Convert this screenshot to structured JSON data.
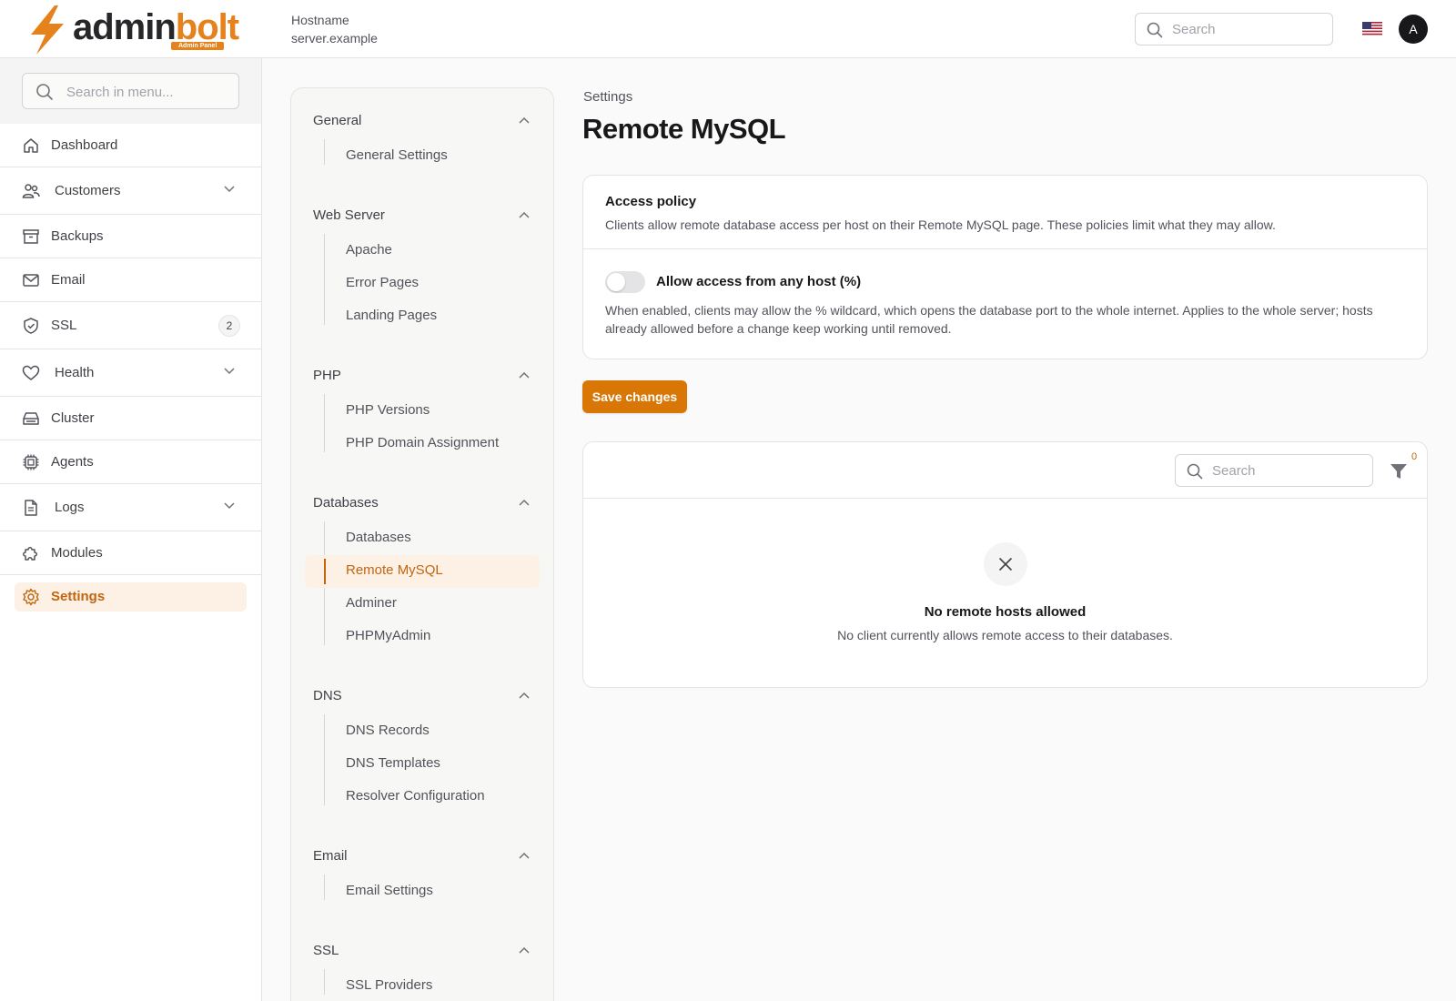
{
  "brand": {
    "name_part1": "admin",
    "name_part2": "bolt",
    "badge": "Admin Panel",
    "accent_color": "#e5821b"
  },
  "header": {
    "hostname_label": "Hostname",
    "hostname_value": "server.example",
    "search_placeholder": "Search",
    "language_flag": "us-flag-icon",
    "avatar_initial": "A"
  },
  "sidebar": {
    "search_placeholder": "Search in menu...",
    "items": [
      {
        "label": "Dashboard",
        "icon": "home-icon"
      },
      {
        "label": "Customers",
        "icon": "users-icon",
        "expandable": true
      },
      {
        "label": "Backups",
        "icon": "archive-icon"
      },
      {
        "label": "Email",
        "icon": "mail-icon"
      },
      {
        "label": "SSL",
        "icon": "shield-check-icon",
        "badge": "2"
      },
      {
        "label": "Health",
        "icon": "heart-icon",
        "expandable": true
      },
      {
        "label": "Cluster",
        "icon": "server-icon"
      },
      {
        "label": "Agents",
        "icon": "cpu-icon"
      },
      {
        "label": "Logs",
        "icon": "file-icon",
        "expandable": true
      },
      {
        "label": "Modules",
        "icon": "puzzle-icon"
      },
      {
        "label": "Settings",
        "icon": "gear-icon",
        "active": true
      }
    ]
  },
  "settings_nav": {
    "groups": [
      {
        "title": "General",
        "items": [
          "General Settings"
        ]
      },
      {
        "title": "Web Server",
        "items": [
          "Apache",
          "Error Pages",
          "Landing Pages"
        ]
      },
      {
        "title": "PHP",
        "items": [
          "PHP Versions",
          "PHP Domain Assignment"
        ]
      },
      {
        "title": "Databases",
        "items": [
          "Databases",
          "Remote MySQL",
          "Adminer",
          "PHPMyAdmin"
        ],
        "active_item": "Remote MySQL"
      },
      {
        "title": "DNS",
        "items": [
          "DNS Records",
          "DNS Templates",
          "Resolver Configuration"
        ]
      },
      {
        "title": "Email",
        "items": [
          "Email Settings"
        ]
      },
      {
        "title": "SSL",
        "items": [
          "SSL Providers"
        ]
      }
    ]
  },
  "main": {
    "breadcrumb": "Settings",
    "title": "Remote MySQL",
    "policy": {
      "title": "Access policy",
      "description": "Clients allow remote database access per host on their Remote MySQL page. These policies limit what they may allow.",
      "toggle_label": "Allow access from any host (%)",
      "toggle_on": false,
      "toggle_help": "When enabled, clients may allow the % wildcard, which opens the database port to the whole internet. Applies to the whole server; hosts already allowed before a change keep working until removed."
    },
    "save_label": "Save changes",
    "table": {
      "search_placeholder": "Search",
      "filter_count": "0",
      "empty_title": "No remote hosts allowed",
      "empty_description": "No client currently allows remote access to their databases."
    }
  }
}
